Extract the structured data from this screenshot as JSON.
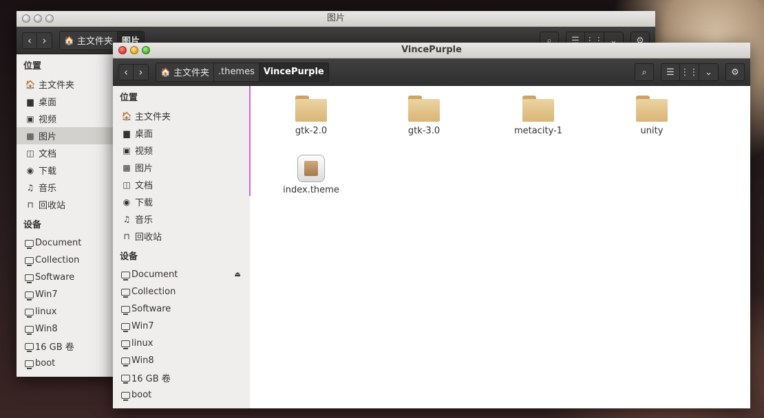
{
  "back_window": {
    "title": "图片",
    "crumbs": [
      "主文件夹",
      "图片"
    ],
    "sidebar": {
      "places_header": "位置",
      "places": [
        {
          "label": "主文件夹",
          "icon": "home-icon",
          "glyph": "🏠"
        },
        {
          "label": "桌面",
          "icon": "desktop-icon",
          "glyph": "▆"
        },
        {
          "label": "视频",
          "icon": "video-icon",
          "glyph": "▣"
        },
        {
          "label": "图片",
          "icon": "pictures-icon",
          "glyph": "▩"
        },
        {
          "label": "文档",
          "icon": "documents-icon",
          "glyph": "◫"
        },
        {
          "label": "下载",
          "icon": "download-icon",
          "glyph": "◉"
        },
        {
          "label": "音乐",
          "icon": "music-icon",
          "glyph": "♫"
        },
        {
          "label": "回收站",
          "icon": "trash-icon",
          "glyph": "⊓"
        }
      ],
      "devices_header": "设备",
      "devices": [
        "Document",
        "Collection",
        "Software",
        "Win7",
        "linux",
        "Win8",
        "16 GB 卷",
        "boot"
      ]
    }
  },
  "front_window": {
    "title": "VincePurple",
    "crumbs": [
      "主文件夹",
      ".themes",
      "VincePurple"
    ],
    "sidebar": {
      "places_header": "位置",
      "places": [
        {
          "label": "主文件夹",
          "icon": "home-icon",
          "glyph": "🏠"
        },
        {
          "label": "桌面",
          "icon": "desktop-icon",
          "glyph": "▆"
        },
        {
          "label": "视频",
          "icon": "video-icon",
          "glyph": "▣"
        },
        {
          "label": "图片",
          "icon": "pictures-icon",
          "glyph": "▩"
        },
        {
          "label": "文档",
          "icon": "documents-icon",
          "glyph": "◫"
        },
        {
          "label": "下载",
          "icon": "download-icon",
          "glyph": "◉"
        },
        {
          "label": "音乐",
          "icon": "music-icon",
          "glyph": "♫"
        },
        {
          "label": "回收站",
          "icon": "trash-icon",
          "glyph": "⊓"
        }
      ],
      "devices_header": "设备",
      "devices": [
        "Document",
        "Collection",
        "Software",
        "Win7",
        "linux",
        "Win8",
        "16 GB 卷",
        "boot"
      ]
    },
    "files": [
      {
        "name": "gtk-2.0",
        "type": "folder"
      },
      {
        "name": "gtk-3.0",
        "type": "folder"
      },
      {
        "name": "metacity-1",
        "type": "folder"
      },
      {
        "name": "unity",
        "type": "folder"
      },
      {
        "name": "index.theme",
        "type": "file"
      }
    ]
  },
  "icons": {
    "back": "‹",
    "forward": "›",
    "search": "⌕",
    "list_view": "☰",
    "grid_view": "⋮⋮",
    "dropdown": "⌄",
    "settings": "⚙",
    "eject": "⏏"
  },
  "colors": {
    "toolbar": "#333333",
    "splitter": "#d066d0"
  }
}
